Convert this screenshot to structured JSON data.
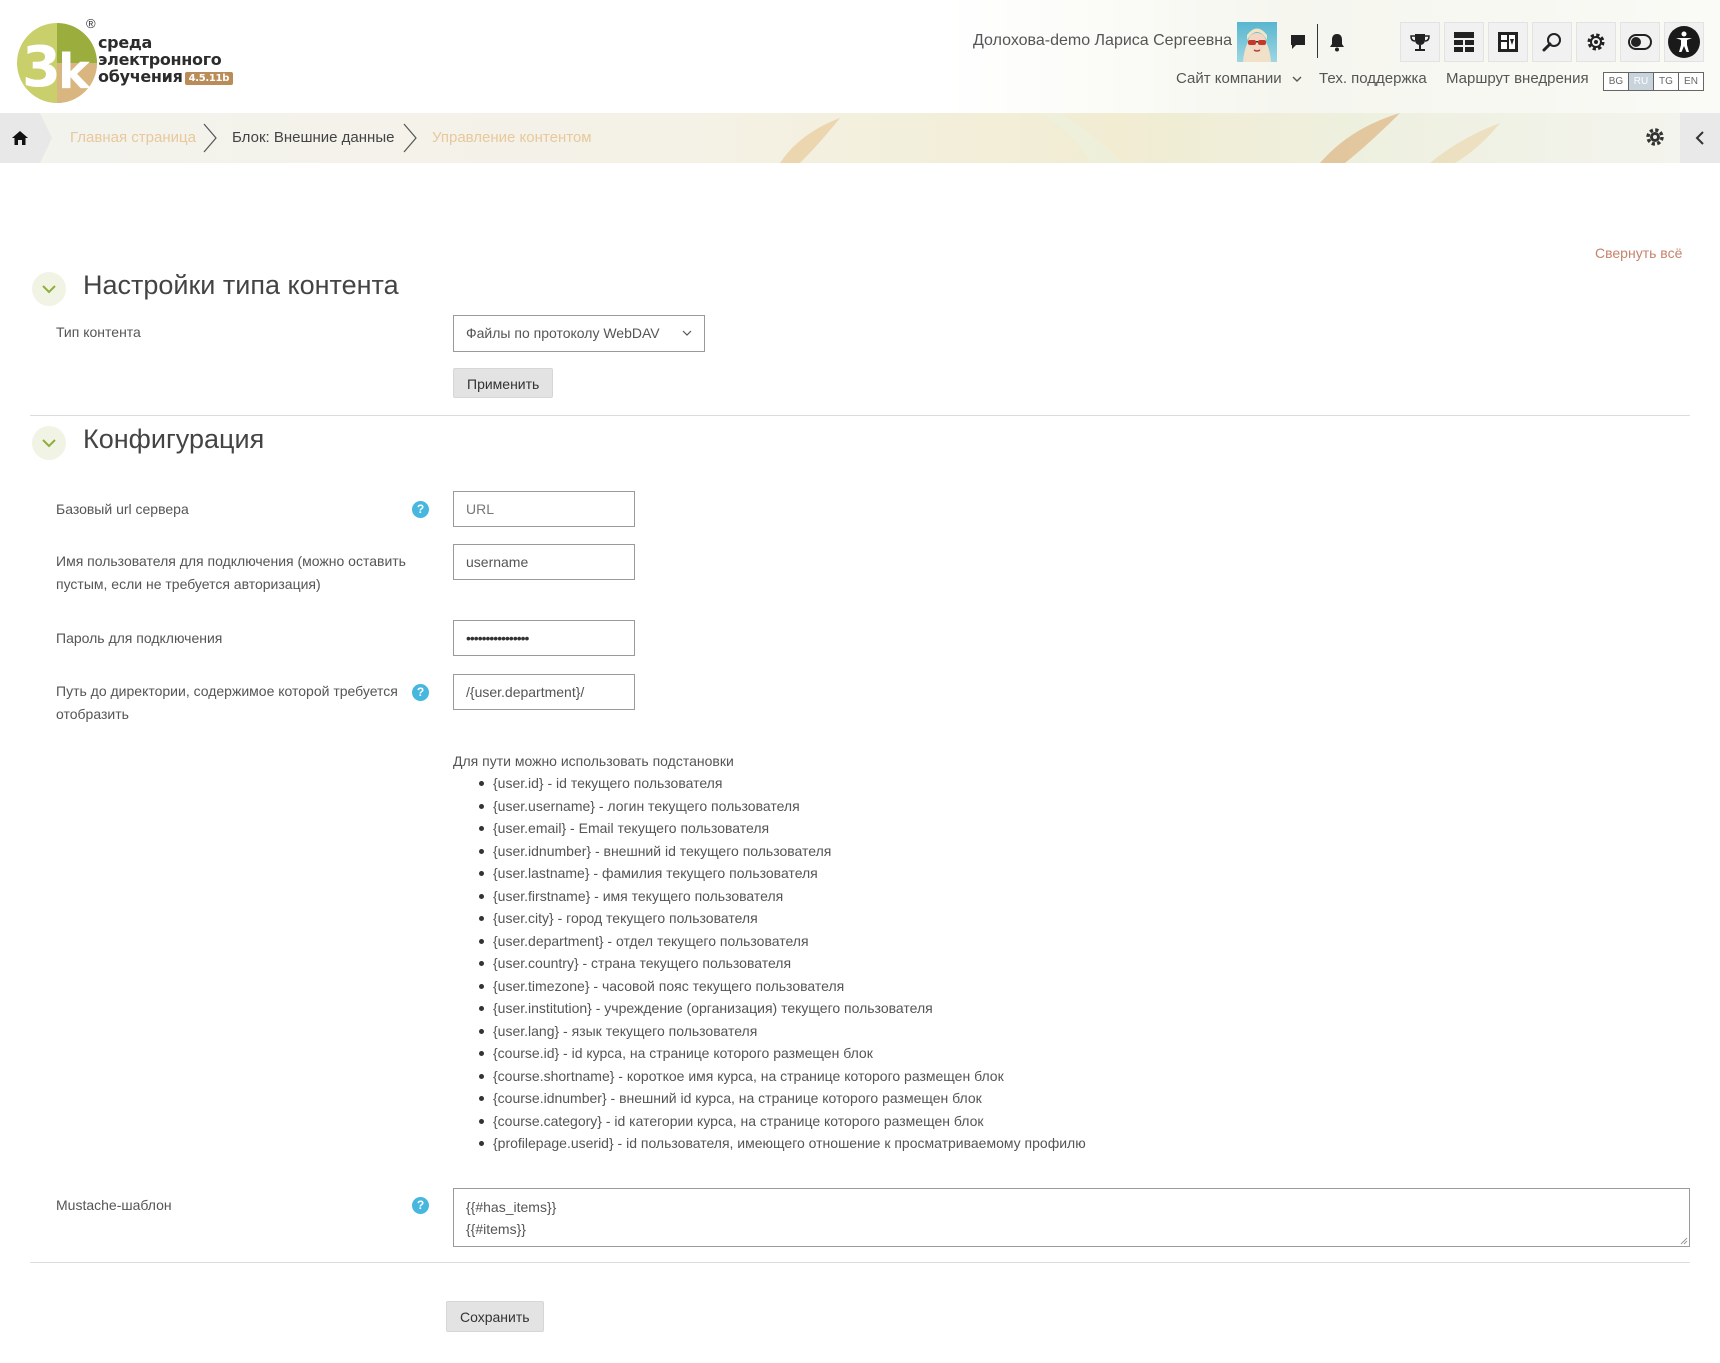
{
  "brand": {
    "logo_line1": "среда",
    "logo_line2": "электронного",
    "logo_line3": "обучения",
    "version": "4.5.11b",
    "registered_mark": "®"
  },
  "header": {
    "user_name": "Долохова-demo Лариса Сергеевна",
    "nav": {
      "company_site": "Сайт компании",
      "support": "Тех. поддержка",
      "roadmap": "Маршрут внедрения"
    },
    "languages": [
      "BG",
      "RU",
      "TG",
      "EN"
    ],
    "active_language": "RU",
    "icons": [
      "chat-icon",
      "bell-icon",
      "trophy-icon",
      "dashboard-icon",
      "layout-icon",
      "search-icon",
      "gear-icon",
      "toggle-icon",
      "accessibility-icon"
    ]
  },
  "breadcrumb": {
    "items": [
      "Главная страница",
      "Блок: Внешние данные",
      "Управление контентом"
    ]
  },
  "collapse_all": "Свернуть всё",
  "content_type_section": {
    "title": "Настройки типа контента",
    "type_label": "Тип контента",
    "type_value": "Файлы по протоколу WebDAV",
    "apply_button": "Применить"
  },
  "config_section": {
    "title": "Конфигурация",
    "fields": {
      "base_url": {
        "label": "Базовый url сервера",
        "placeholder": "URL"
      },
      "username": {
        "label": "Имя пользователя для подключения (можно оставить пустым, если не требуется авторизация)",
        "value": "username"
      },
      "password": {
        "label": "Пароль для подключения",
        "value": "••••••••••••••••"
      },
      "path": {
        "label": "Путь до директории, содержимое которой требуется отобразить",
        "value": "/{user.department}/"
      },
      "mustache": {
        "label": "Mustache-шаблон",
        "line1": "{{#has_items}}",
        "line2": "{{#items}}"
      }
    },
    "hint_intro": "Для пути можно использовать подстановки",
    "substitutions": [
      "{user.id} - id текущего пользователя",
      "{user.username} - логин текущего пользователя",
      "{user.email} - Email текущего пользователя",
      "{user.idnumber} - внешний id текущего пользователя",
      "{user.lastname} - фамилия текущего пользователя",
      "{user.firstname} - имя текущего пользователя",
      "{user.city} - город текущего пользователя",
      "{user.department} - отдел текущего пользователя",
      "{user.country} - страна текущего пользователя",
      "{user.timezone} - часовой пояс текущего пользователя",
      "{user.institution} - учреждение (организация) текущего пользователя",
      "{user.lang} - язык текущего пользователя",
      "{course.id} - id курса, на странице которого размещен блок",
      "{course.shortname} - короткое имя курса, на странице которого размещен блок",
      "{course.idnumber} - внешний id курса, на странице которого размещен блок",
      "{course.category} - id категории курса, на странице которого размещен блок",
      "{profilepage.userid} - id пользователя, имеющего отношение к просматриваемому профилю"
    ],
    "help_mark": "?"
  },
  "save_button": "Сохранить"
}
